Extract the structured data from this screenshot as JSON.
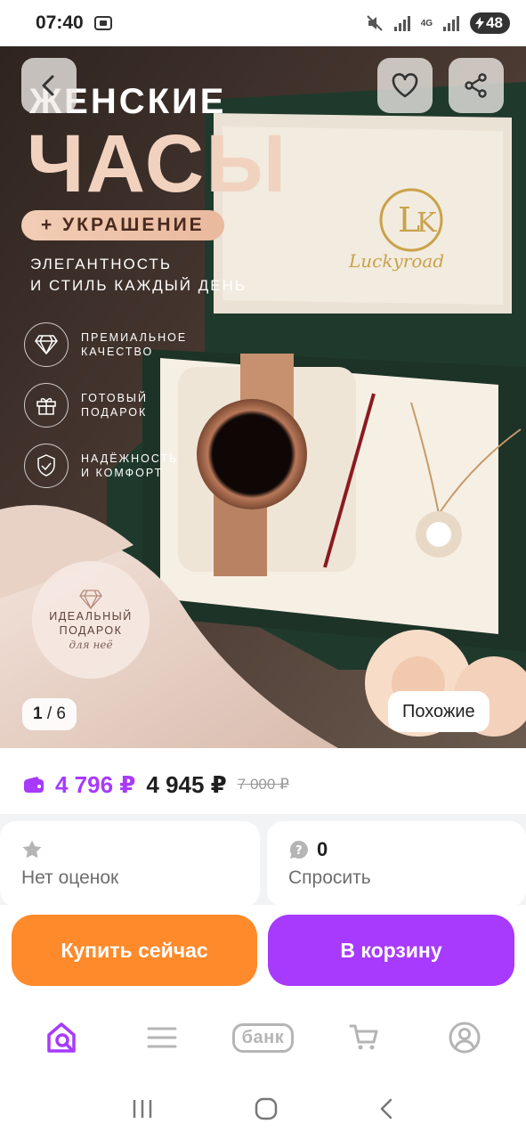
{
  "status_bar": {
    "time": "07:40",
    "network": "4G",
    "battery": "48"
  },
  "product_gallery": {
    "title_line1": "ЖЕНСКИЕ",
    "title_line2": "ЧАСЫ",
    "pill": "+ УКРАШЕНИЕ",
    "tagline": "ЭЛЕГАНТНОСТЬ\nИ СТИЛЬ КАЖДЫЙ ДЕНЬ",
    "features": [
      {
        "icon": "diamond-icon",
        "text": "ПРЕМИАЛЬНОЕ\nКАЧЕСТВО"
      },
      {
        "icon": "gift-icon",
        "text": "ГОТОВЫЙ\nПОДАРОК"
      },
      {
        "icon": "shield-check-icon",
        "text": "НАДЁЖНОСТЬ\nИ КОМФОРТ"
      }
    ],
    "badge_text": "ИДЕАЛЬНЫЙ\nПОДАРОК",
    "badge_script": "для неё",
    "brand_logo_text": "Luckyroad",
    "current_image": "1",
    "total_images": "6",
    "similar_label": "Похожие"
  },
  "prices": {
    "card_price": "4 796 ₽",
    "price": "4 945 ₽",
    "old_price": "7 000 ₽"
  },
  "rating": {
    "label": "Нет оценок"
  },
  "questions": {
    "count": "0",
    "label": "Спросить"
  },
  "actions": {
    "buy_now": "Купить сейчас",
    "add_to_cart": "В корзину"
  },
  "bottom_nav": {
    "bank_label": "банк"
  },
  "colors": {
    "accent_purple": "#a73afd",
    "accent_orange": "#ff8a2b"
  }
}
